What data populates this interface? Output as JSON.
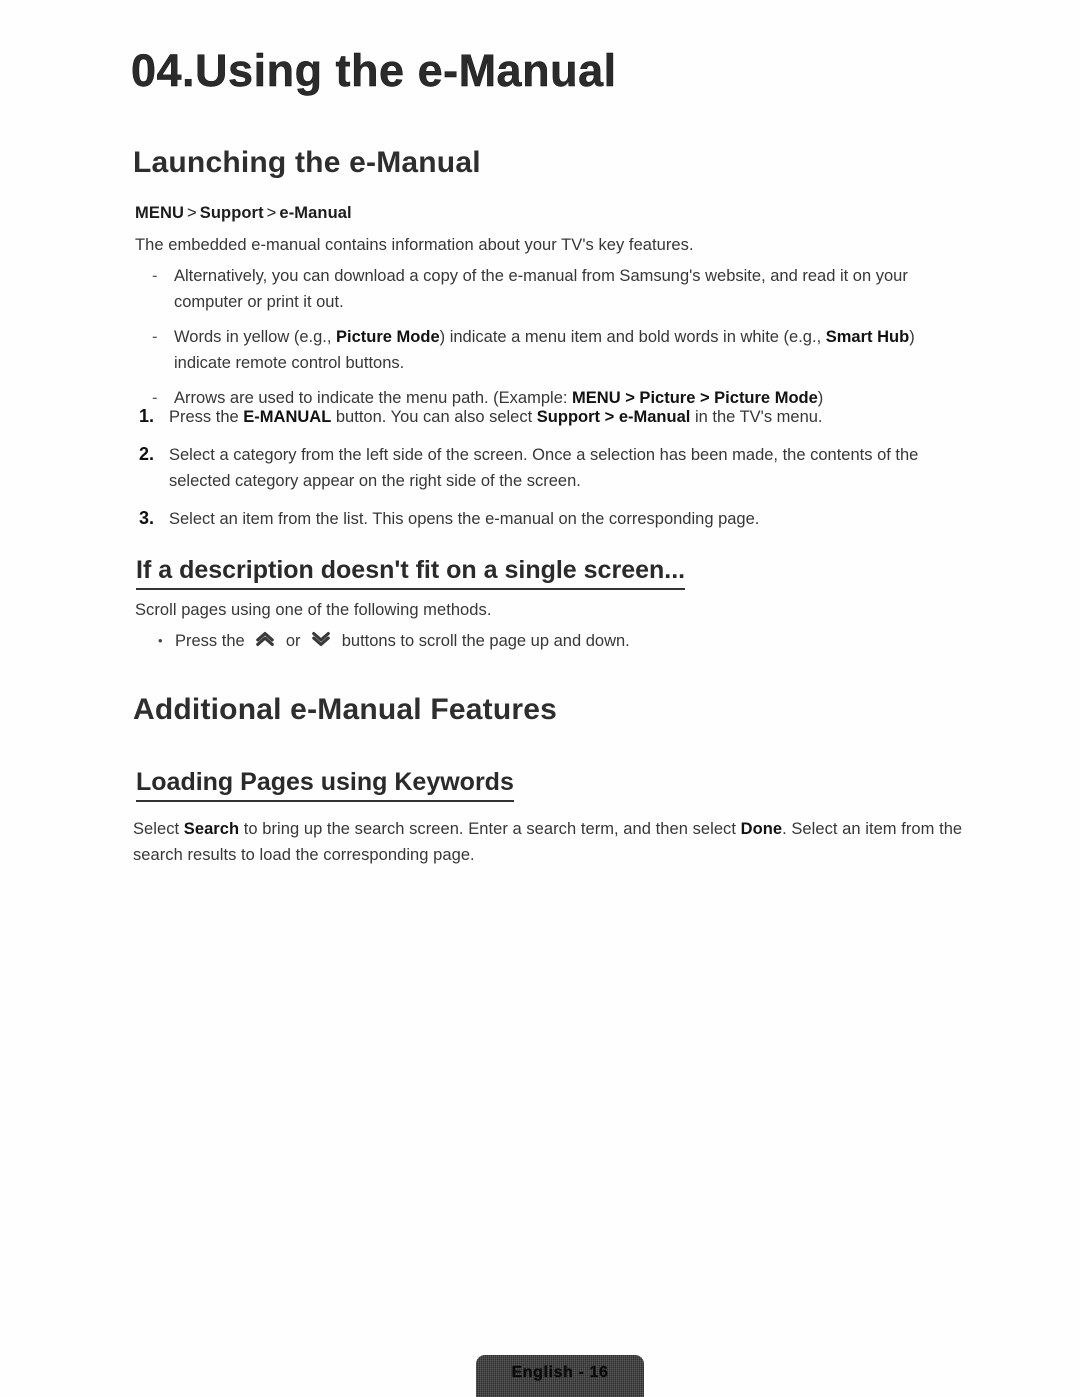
{
  "chapter": {
    "title": "04.Using the e-Manual"
  },
  "sections": {
    "launching": {
      "heading": "Launching the e-Manual",
      "menu_path": {
        "items": [
          "MENU",
          "Support",
          "e-Manual"
        ],
        "separator": ">"
      },
      "intro": "The embedded e-manual contains information about your TV's key features.",
      "dash_items": [
        {
          "marker": "-",
          "parts": [
            {
              "text": "Alternatively, you can download a copy of the e-manual from Samsung's website, and read it on your computer or print it out.",
              "bold": false
            }
          ]
        },
        {
          "marker": "-",
          "parts": [
            {
              "text": "Words in yellow (e.g., ",
              "bold": false
            },
            {
              "text": "Picture Mode",
              "bold": true
            },
            {
              "text": ") indicate a menu item and bold words in white (e.g., ",
              "bold": false
            },
            {
              "text": "Smart Hub",
              "bold": true
            },
            {
              "text": ") indicate remote control buttons.",
              "bold": false
            }
          ]
        },
        {
          "marker": "-",
          "parts": [
            {
              "text": "Arrows are used to indicate the menu path. (Example: ",
              "bold": false
            },
            {
              "text": "MENU > Picture > Picture Mode",
              "bold": true
            },
            {
              "text": ")",
              "bold": false
            }
          ]
        }
      ],
      "numbered_items": [
        {
          "marker": "1.",
          "parts": [
            {
              "text": "Press the ",
              "bold": false
            },
            {
              "text": "E-MANUAL",
              "bold": true
            },
            {
              "text": " button. You can also select ",
              "bold": false
            },
            {
              "text": "Support > e-Manual",
              "bold": true
            },
            {
              "text": " in the TV's menu.",
              "bold": false
            }
          ]
        },
        {
          "marker": "2.",
          "parts": [
            {
              "text": "Select a category from the left side of the screen. Once a selection has been made, the contents of the selected category appear on the right side of the screen.",
              "bold": false
            }
          ]
        },
        {
          "marker": "3.",
          "parts": [
            {
              "text": "Select an item from the list. This opens the e-manual on the corresponding page.",
              "bold": false
            }
          ]
        }
      ]
    },
    "description_fit": {
      "heading": "If a description doesn't fit on a single screen...",
      "intro": "Scroll pages using one of the following methods.",
      "bullet_items": [
        {
          "marker": "•",
          "parts": [
            {
              "text": "Press the ",
              "bold": false
            },
            {
              "icon": "chevron-double-up-icon"
            },
            {
              "text": " or ",
              "bold": false
            },
            {
              "icon": "chevron-double-down-icon"
            },
            {
              "text": " buttons to scroll the page up and down.",
              "bold": false
            }
          ]
        }
      ]
    },
    "additional": {
      "heading": "Additional e-Manual Features",
      "loading_pages": {
        "heading": "Loading Pages using Keywords",
        "parts": [
          {
            "text": "Select ",
            "bold": false
          },
          {
            "text": "Search",
            "bold": true
          },
          {
            "text": " to bring up the search screen. Enter a search term, and then select ",
            "bold": false
          },
          {
            "text": "Done",
            "bold": true
          },
          {
            "text": ". Select an item from the search results to load the corresponding page.",
            "bold": false
          }
        ]
      }
    }
  },
  "footer": {
    "label": "English - 16"
  },
  "colors": {
    "page_background": "#fefefe",
    "body_text": "#373737",
    "heading_text": "#2e2e2e",
    "footer_badge_background": "#2d2d2d"
  }
}
